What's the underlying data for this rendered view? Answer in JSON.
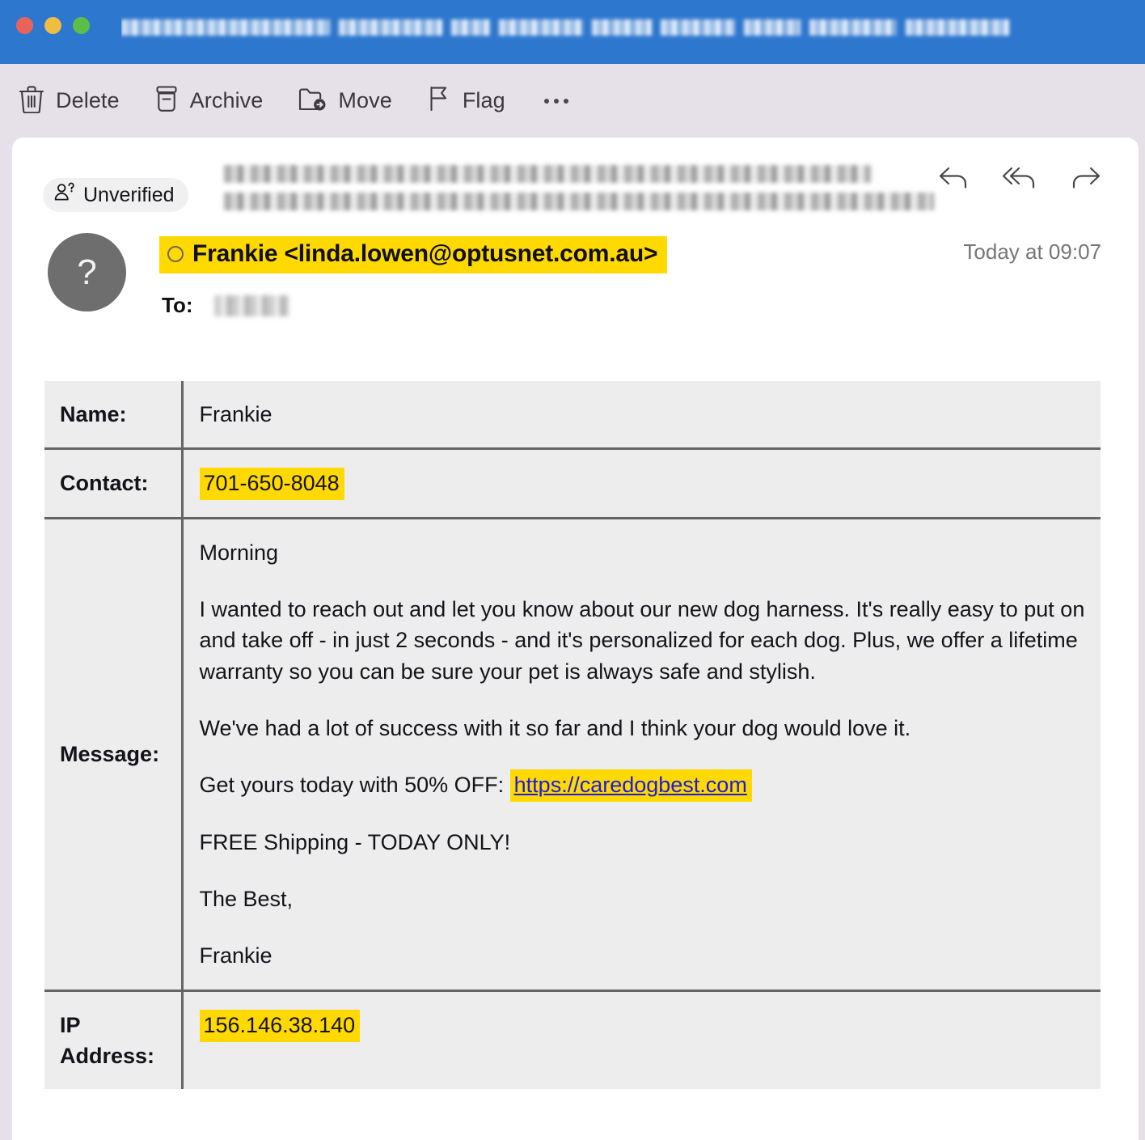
{
  "window": {
    "titlebar_color": "#2e77ce",
    "title_redacted": true,
    "traffic_lights": [
      "close",
      "minimize",
      "zoom"
    ]
  },
  "toolbar": {
    "items": [
      {
        "label": "Delete",
        "icon": "trash-icon"
      },
      {
        "label": "Archive",
        "icon": "archive-box-icon"
      },
      {
        "label": "Move",
        "icon": "folder-arrow-icon"
      },
      {
        "label": "Flag",
        "icon": "flag-icon"
      }
    ],
    "overflow_label": "…"
  },
  "message_header": {
    "badge": {
      "label": "Unverified",
      "icon": "person-question-icon"
    },
    "subject_redacted": true,
    "avatar": {
      "glyph": "?",
      "color": "#6e6e6e"
    },
    "from": "Frankie <linda.lowen@optusnet.com.au>",
    "from_highlighted": true,
    "to_label": "To:",
    "to_redacted": true,
    "timestamp": "Today at 09:07",
    "actions": [
      {
        "name": "reply",
        "icon": "reply-arrow-icon"
      },
      {
        "name": "reply-all",
        "icon": "reply-all-arrow-icon"
      },
      {
        "name": "forward",
        "icon": "forward-arrow-icon"
      }
    ]
  },
  "table": {
    "name_label": "Name:",
    "name_value": "Frankie",
    "contact_label": "Contact:",
    "contact_value": "701-650-8048",
    "message_label": "Message:",
    "message_paragraphs": [
      "Morning",
      "I wanted to reach out and let you know about our new dog harness. It's really easy to put on and take off - in just 2 seconds - and it's personalized for each dog. Plus, we offer a lifetime warranty so you can be sure your pet is always safe and stylish.",
      "We've had a lot of success with it so far and I think your dog would love it.",
      "FREE Shipping - TODAY ONLY!",
      "The Best,",
      "Frankie"
    ],
    "offer_prefix": "Get yours today with 50% OFF: ",
    "offer_link": "https://caredogbest.com",
    "ip_label_line1": "IP",
    "ip_label_line2": "Address:",
    "ip_value": "156.146.38.140"
  },
  "colors": {
    "highlight": "#ffd900",
    "link": "#1a1ae6",
    "titlebar": "#2e77ce",
    "toolbar_bg": "#e6e1e8",
    "table_cell_bg": "#ededed",
    "table_border": "#646464"
  }
}
